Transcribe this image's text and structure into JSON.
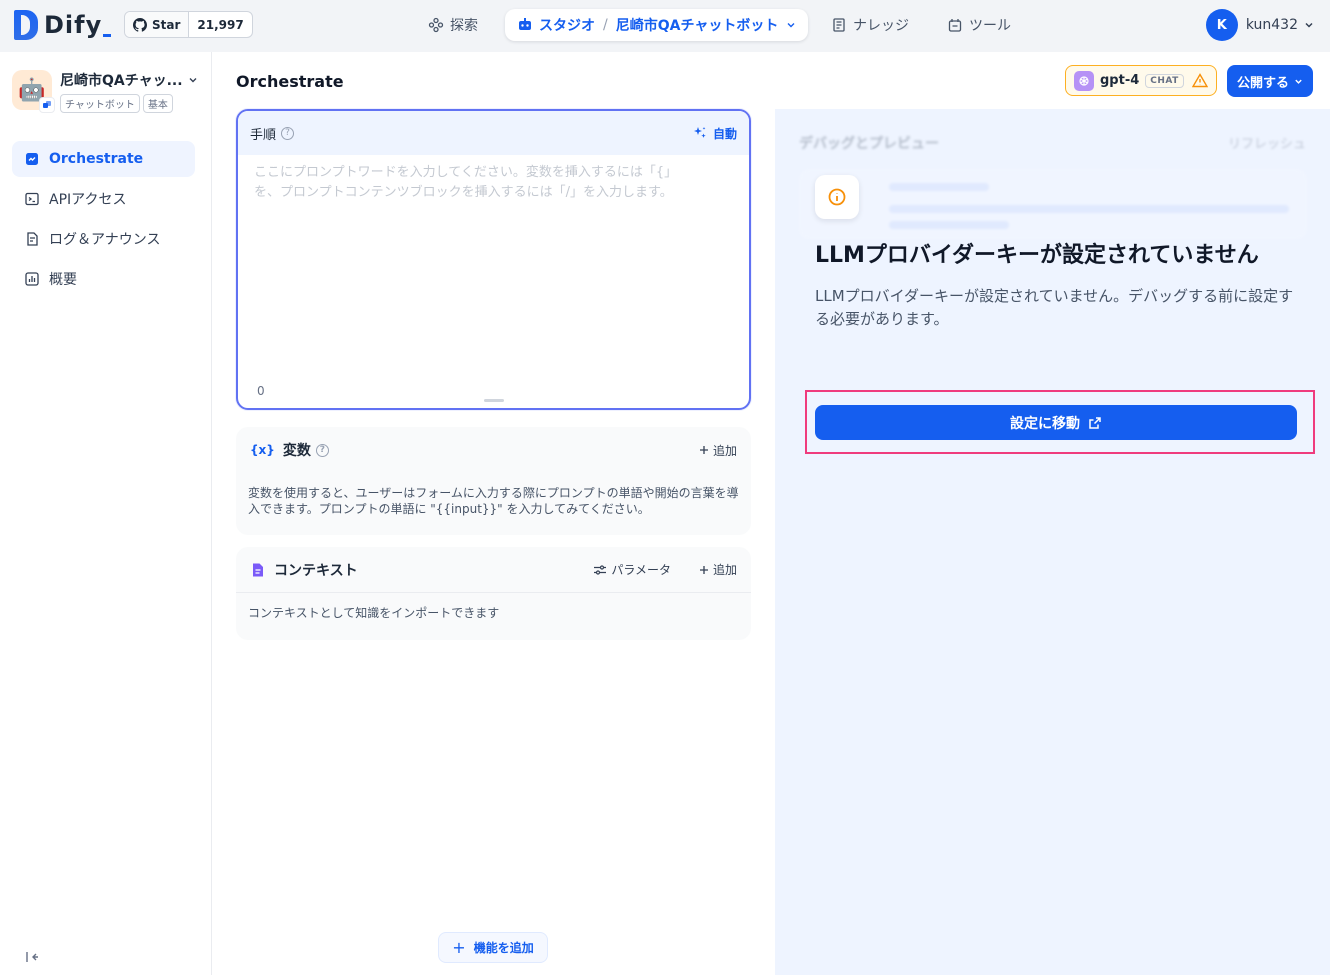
{
  "brand": {
    "name": "Dify",
    "color": "#155eef"
  },
  "github": {
    "star_label": "Star",
    "count": "21,997"
  },
  "nav": {
    "explore": "探索",
    "studio": "スタジオ",
    "app_name": "尼崎市QAチャットボット",
    "knowledge": "ナレッジ",
    "tools": "ツール"
  },
  "user": {
    "initial": "K",
    "name": "kun432"
  },
  "sidebar": {
    "app_title": "尼崎市QAチャッ...",
    "app_tags": [
      "チャットボット",
      "基本"
    ],
    "items": [
      {
        "label": "Orchestrate",
        "icon": "orchestrate-icon",
        "active": true
      },
      {
        "label": "APIアクセス",
        "icon": "terminal-icon",
        "active": false
      },
      {
        "label": "ログ＆アナウンス",
        "icon": "log-icon",
        "active": false
      },
      {
        "label": "概要",
        "icon": "chart-icon",
        "active": false
      }
    ]
  },
  "main": {
    "title": "Orchestrate",
    "model_name": "gpt-4",
    "model_mode": "CHAT",
    "publish_label": "公開する",
    "prompt": {
      "title": "手順",
      "auto_label": "自動",
      "placeholder_line1": "ここにプロンプトワードを入力してください。変数を挿入するには「{」",
      "placeholder_line2": "を、プロンプトコンテンツブロックを挿入するには「/」を入力します。",
      "char_count": "0"
    },
    "variables": {
      "title": "変数",
      "add_label": "追加",
      "desc": "変数を使用すると、ユーザーはフォームに入力する際にプロンプトの単語や開始の言葉を導入できます。プロンプトの単語に \"{{input}}\" を入力してみてください。"
    },
    "context": {
      "title": "コンテキスト",
      "params_label": "パラメータ",
      "add_label": "追加",
      "desc": "コンテキストとして知識をインポートできます"
    },
    "add_feature_label": "機能を追加"
  },
  "debug": {
    "faded_title": "デバッグとプレビュー",
    "faded_refresh": "リフレッシュ",
    "alert_title": "LLMプロバイダーキーが設定されていません",
    "alert_desc": "LLMプロバイダーキーが設定されていません。デバッグする前に設定する必要があります。",
    "goto_label": "設定に移動"
  },
  "colors": {
    "highlight": "#ef3b7d",
    "warning": "#f79009",
    "primary": "#155eef"
  }
}
